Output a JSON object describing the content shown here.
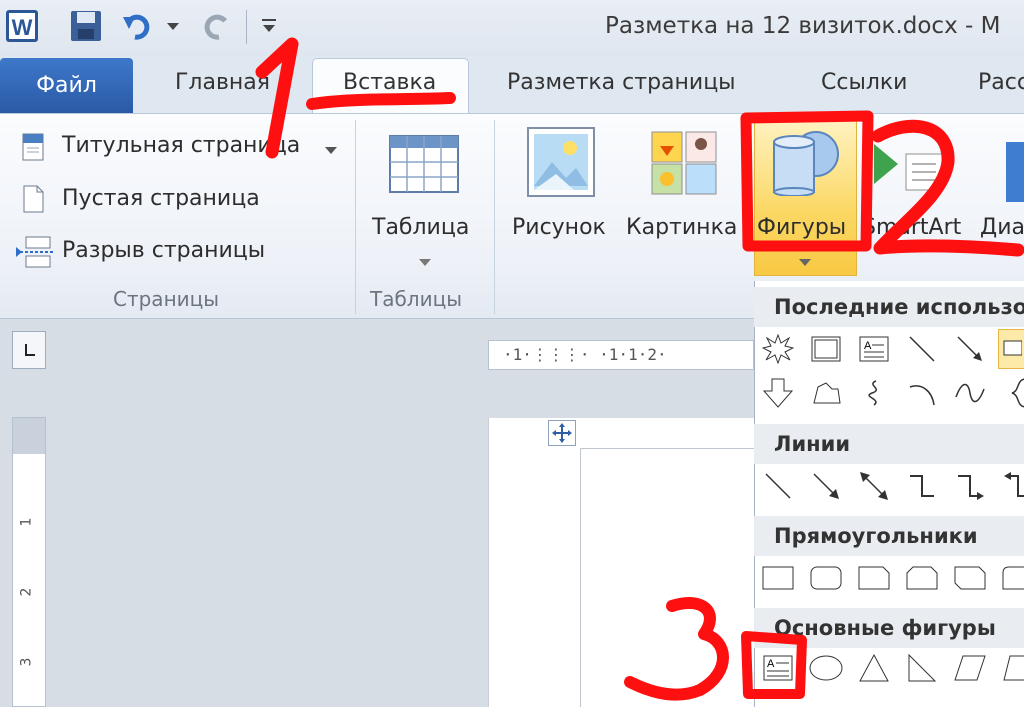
{
  "window": {
    "title": "Разметка на 12 визиток.docx  -  M"
  },
  "quick_access": {
    "app_icon": "word-icon",
    "save_icon": "save-icon",
    "undo_icon": "undo-icon",
    "redo_icon": "redo-icon",
    "customize_icon": "customize-icon"
  },
  "tabs": [
    {
      "label": "Файл"
    },
    {
      "label": "Главная"
    },
    {
      "label": "Вставка"
    },
    {
      "label": "Разметка страницы"
    },
    {
      "label": "Ссылки"
    },
    {
      "label": "Расс"
    }
  ],
  "ribbon": {
    "pages": {
      "title_page": "Титульная страница",
      "blank_page": "Пустая страница",
      "page_break": "Разрыв страницы",
      "group_label": "Страницы"
    },
    "tables": {
      "table": "Таблица",
      "group_label": "Таблицы"
    },
    "illustrations": {
      "picture": "Рисунок",
      "clipart": "Картинка",
      "shapes": "Фигуры",
      "smartart": "SmartArt",
      "chart": "Диа"
    }
  },
  "ruler": {
    "marks": "·1·⋮⋮⋮· ·1·1·2·"
  },
  "vruler": {
    "numbers": [
      "1",
      "2",
      "3"
    ]
  },
  "shapes_menu": {
    "sections": [
      {
        "title": "Последние использованные фигуры"
      },
      {
        "title": "Линии"
      },
      {
        "title": "Прямоугольники"
      },
      {
        "title": "Основные фигуры"
      }
    ]
  },
  "annotations": {
    "one": "1",
    "two": "2",
    "three": "3",
    "color": "#ff1010"
  },
  "colors": {
    "file_tab": "#2a5aa6",
    "highlight": "#fbd864"
  }
}
